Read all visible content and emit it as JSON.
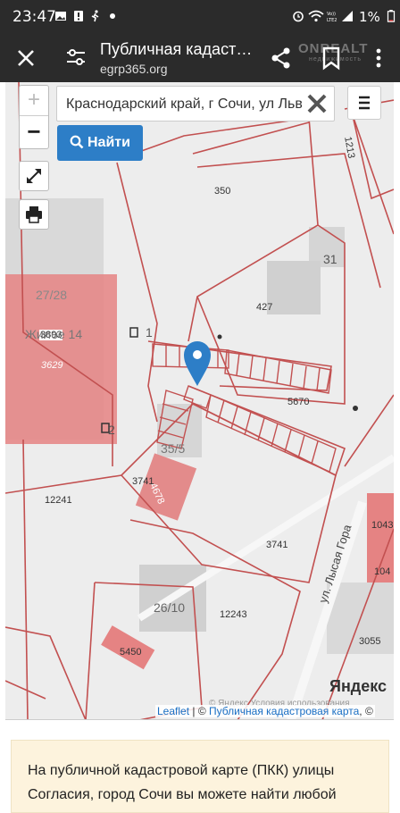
{
  "status_bar": {
    "time": "23:47",
    "battery_pct": "1%",
    "icons": [
      "gallery-icon",
      "alert-icon",
      "walk-icon",
      "notification-dot",
      "alarm-icon",
      "wifi-icon",
      "volte-icon",
      "signal-icon",
      "battery-icon"
    ]
  },
  "toolbar": {
    "title": "Публичная кадаст…",
    "url": "egrp365.org",
    "watermark": "ONREALT",
    "watermark_sub": "недвижимость"
  },
  "map": {
    "search_value": "Краснодарский край, г Сочи, ул Льв",
    "search_button": "Найти",
    "zoom_in": "+",
    "zoom_out": "−",
    "labels": {
      "l350": "350",
      "l31": "31",
      "l427": "427",
      "l2728": "27/28",
      "l3893": "3893",
      "lzhil": "Жилое 14",
      "l3629": "3629",
      "l1": "1",
      "l5670": "5670",
      "l2": "2",
      "l355": "35/5",
      "l3741a": "3741",
      "l4678": "4678",
      "l12241": "12241",
      "l3741b": "3741",
      "l1043": "1043",
      "l104": "104",
      "l2610": "26/10",
      "l12243": "12243",
      "l5450": "5450",
      "l3055": "3055",
      "l1213": "1213",
      "street": "ул. Лысая Гора",
      "yandex": "Яндекс",
      "yandex_copy": "© Яндекс   Условия использования"
    },
    "attribution": {
      "leaflet": "Leaflet",
      "sep": " | © ",
      "source": "Публичная кадастровая карта",
      "tail": ", ©"
    }
  },
  "info": {
    "text": "На публичной кадастровой карте (ПКК) улицы Согласия, город Сочи вы можете найти любой"
  }
}
